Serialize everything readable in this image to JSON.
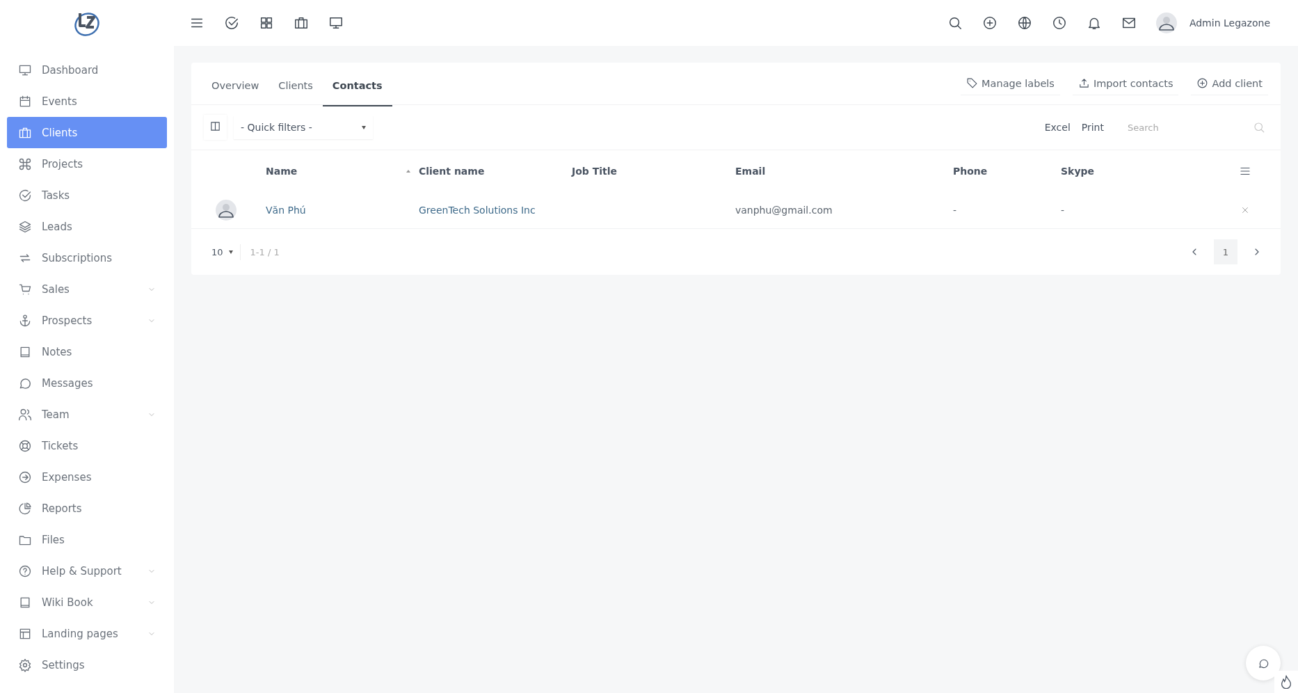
{
  "topbar": {
    "user_name": "Admin Legazone"
  },
  "sidebar": {
    "items": [
      {
        "label": "Dashboard",
        "selected": false,
        "has_submenu": false
      },
      {
        "label": "Events",
        "selected": false,
        "has_submenu": false
      },
      {
        "label": "Clients",
        "selected": true,
        "has_submenu": false
      },
      {
        "label": "Projects",
        "selected": false,
        "has_submenu": false
      },
      {
        "label": "Tasks",
        "selected": false,
        "has_submenu": false
      },
      {
        "label": "Leads",
        "selected": false,
        "has_submenu": false
      },
      {
        "label": "Subscriptions",
        "selected": false,
        "has_submenu": false
      },
      {
        "label": "Sales",
        "selected": false,
        "has_submenu": true
      },
      {
        "label": "Prospects",
        "selected": false,
        "has_submenu": true
      },
      {
        "label": "Notes",
        "selected": false,
        "has_submenu": false
      },
      {
        "label": "Messages",
        "selected": false,
        "has_submenu": false
      },
      {
        "label": "Team",
        "selected": false,
        "has_submenu": true
      },
      {
        "label": "Tickets",
        "selected": false,
        "has_submenu": false
      },
      {
        "label": "Expenses",
        "selected": false,
        "has_submenu": false
      },
      {
        "label": "Reports",
        "selected": false,
        "has_submenu": false
      },
      {
        "label": "Files",
        "selected": false,
        "has_submenu": false
      },
      {
        "label": "Help & Support",
        "selected": false,
        "has_submenu": true
      },
      {
        "label": "Wiki Book",
        "selected": false,
        "has_submenu": true
      },
      {
        "label": "Landing pages",
        "selected": false,
        "has_submenu": true
      },
      {
        "label": "Settings",
        "selected": false,
        "has_submenu": false
      }
    ]
  },
  "tabs": [
    {
      "label": "Overview",
      "selected": false
    },
    {
      "label": "Clients",
      "selected": false
    },
    {
      "label": "Contacts",
      "selected": true
    }
  ],
  "actions": [
    "Manage labels",
    "Import contacts",
    "Add client"
  ],
  "toolbar": {
    "quick_filter": "- Quick filters -",
    "export_buttons": [
      "Excel",
      "Print"
    ],
    "search": {
      "placeholder": "Search"
    }
  },
  "table": {
    "columns": [
      "Name",
      "Client name",
      "Job Title",
      "Email",
      "Phone",
      "Skype"
    ],
    "rows": [
      {
        "name": "Văn Phú",
        "client_name": "GreenTech Solutions Inc",
        "email": "vanphu@gmail.com",
        "phone": "-",
        "skype": "-"
      }
    ]
  },
  "footer": {
    "page_size": "10",
    "range": "1-1 / 1",
    "pages": [
      {
        "label": "1",
        "selected": true
      }
    ]
  }
}
